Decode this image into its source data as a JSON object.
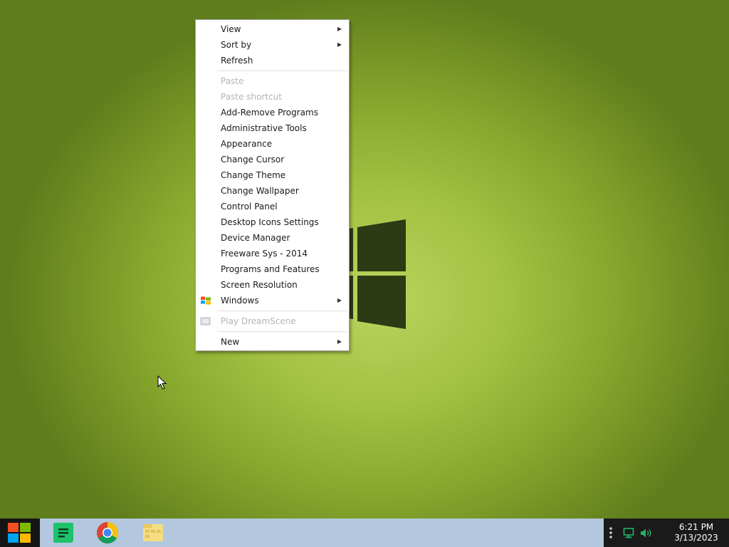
{
  "context_menu": {
    "items": [
      {
        "label": "View",
        "submenu": true,
        "enabled": true
      },
      {
        "label": "Sort by",
        "submenu": true,
        "enabled": true
      },
      {
        "label": "Refresh",
        "enabled": true
      },
      {
        "label": "Paste",
        "enabled": false
      },
      {
        "label": "Paste shortcut",
        "enabled": false
      },
      {
        "label": "Add-Remove Programs",
        "enabled": true
      },
      {
        "label": "Administrative Tools",
        "enabled": true
      },
      {
        "label": "Appearance",
        "enabled": true
      },
      {
        "label": "Change Cursor",
        "enabled": true
      },
      {
        "label": "Change Theme",
        "enabled": true
      },
      {
        "label": "Change Wallpaper",
        "enabled": true
      },
      {
        "label": "Control Panel",
        "enabled": true
      },
      {
        "label": "Desktop Icons Settings",
        "enabled": true
      },
      {
        "label": "Device Manager",
        "enabled": true
      },
      {
        "label": "Freeware Sys - 2014",
        "enabled": true
      },
      {
        "label": "Programs and Features",
        "enabled": true
      },
      {
        "label": "Screen Resolution",
        "enabled": true
      },
      {
        "label": "Windows",
        "submenu": true,
        "enabled": true,
        "icon": "windows-flag-icon"
      },
      {
        "label": "Play DreamScene",
        "enabled": false,
        "icon": "dreamscene-icon"
      },
      {
        "label": "New",
        "submenu": true,
        "enabled": true
      }
    ],
    "submenu_arrow": "▶"
  },
  "taskbar": {
    "start_icon": "windows-logo-icon",
    "apps": [
      {
        "name": "notes-app",
        "icon": "notes-icon",
        "color": "#1ec26b"
      },
      {
        "name": "chrome",
        "icon": "chrome-icon"
      },
      {
        "name": "file-explorer",
        "icon": "folder-icon",
        "color": "#f3dc82"
      }
    ],
    "tray": {
      "icons": [
        "overflow-dots-icon",
        "network-icon",
        "volume-icon"
      ],
      "time": "6:21 PM",
      "date": "3/13/2023"
    }
  },
  "colors": {
    "desktop_center": "#bcd45e",
    "desktop_edge": "#5f7d1c",
    "taskbar": "#b3c8df",
    "tray": "#1a1a1a",
    "disabled_text": "#b4b4b4"
  }
}
